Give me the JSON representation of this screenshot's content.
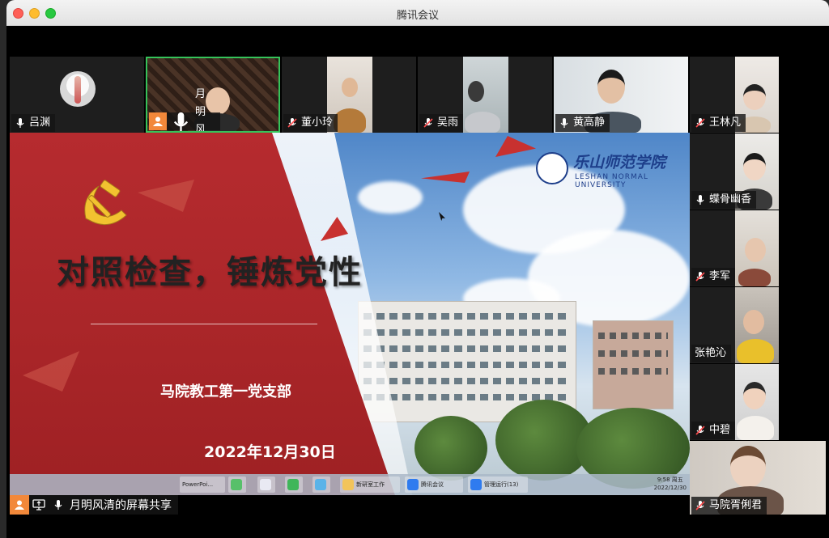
{
  "window": {
    "title": "腾讯会议"
  },
  "participants_top": [
    {
      "name": "吕渊",
      "mic": "on"
    },
    {
      "name": "月明风清",
      "mic": "on",
      "host": true,
      "active": true
    },
    {
      "name": "董小玲",
      "mic": "muted"
    },
    {
      "name": "吴雨",
      "mic": "muted"
    },
    {
      "name": "黄高静",
      "mic": "on"
    },
    {
      "name": "王林凡",
      "mic": "muted"
    }
  ],
  "participants_side": [
    {
      "name": "蝶骨幽香",
      "mic": "on"
    },
    {
      "name": "李军",
      "mic": "muted"
    },
    {
      "name": "张艳沁",
      "mic": "none"
    },
    {
      "name": "中碧",
      "mic": "muted"
    },
    {
      "name": "马院胥俐君",
      "mic": "muted"
    }
  ],
  "slide": {
    "title": "对照检查，锤炼党性",
    "subtitle": "马院教工第一党支部",
    "date": "2022年12月30日",
    "school_cn": "乐山师范学院",
    "school_en": "LESHAN NORMAL UNIVERSITY"
  },
  "taskbar": {
    "items": [
      "PowerPoi...",
      "新研室工作",
      "腾讯会议",
      "管理运行(13)"
    ],
    "time": "9:58 周五",
    "date": "2022/12/30"
  },
  "share_bar": {
    "label": "月明风清的屏幕共享"
  },
  "colors": {
    "host_badge": "#f2883a",
    "active_border": "#35c35a",
    "party_red": "#b62b2f"
  }
}
